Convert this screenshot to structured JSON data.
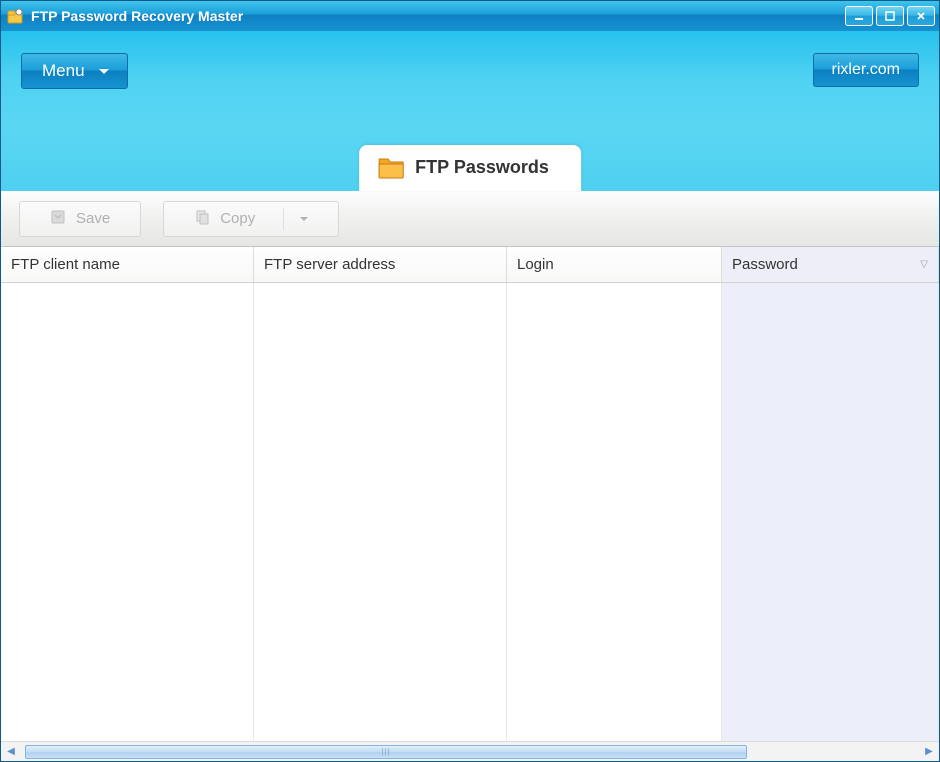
{
  "window": {
    "title": "FTP Password Recovery Master"
  },
  "header": {
    "menu_label": "Menu",
    "link_label": "rixler.com"
  },
  "tab": {
    "label": "FTP Passwords"
  },
  "toolbar": {
    "save_label": "Save",
    "copy_label": "Copy"
  },
  "table": {
    "columns": {
      "client": "FTP client name",
      "server": "FTP server address",
      "login": "Login",
      "password": "Password"
    },
    "sorted_column": "password",
    "rows": []
  }
}
